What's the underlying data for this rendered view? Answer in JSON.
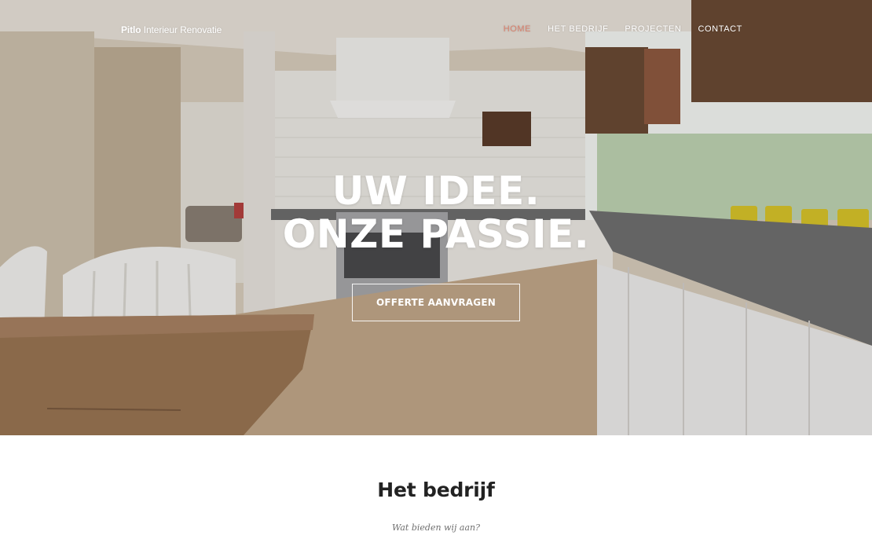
{
  "header": {
    "brand_strong": "Pitlo",
    "brand_rest": "Interieur Renovatie",
    "nav": [
      {
        "label": "HOME",
        "active": true
      },
      {
        "label": "HET BEDRIJF",
        "active": false
      },
      {
        "label": "PROJECTEN",
        "active": false
      },
      {
        "label": "CONTACT",
        "active": false
      }
    ]
  },
  "hero": {
    "headline_line1": "UW IDEE.",
    "headline_line2": "ONZE PASSIE.",
    "cta_label": "OFFERTE AANVRAGEN",
    "image": "kitchen-interior-photo"
  },
  "section": {
    "title": "Het bedrijf",
    "subtitle": "Wat bieden wij aan?"
  },
  "colors": {
    "accent": "#d9816e",
    "nav_text": "#ffffff",
    "heading_text": "#222222",
    "subtitle_text": "#6f6f6f"
  }
}
